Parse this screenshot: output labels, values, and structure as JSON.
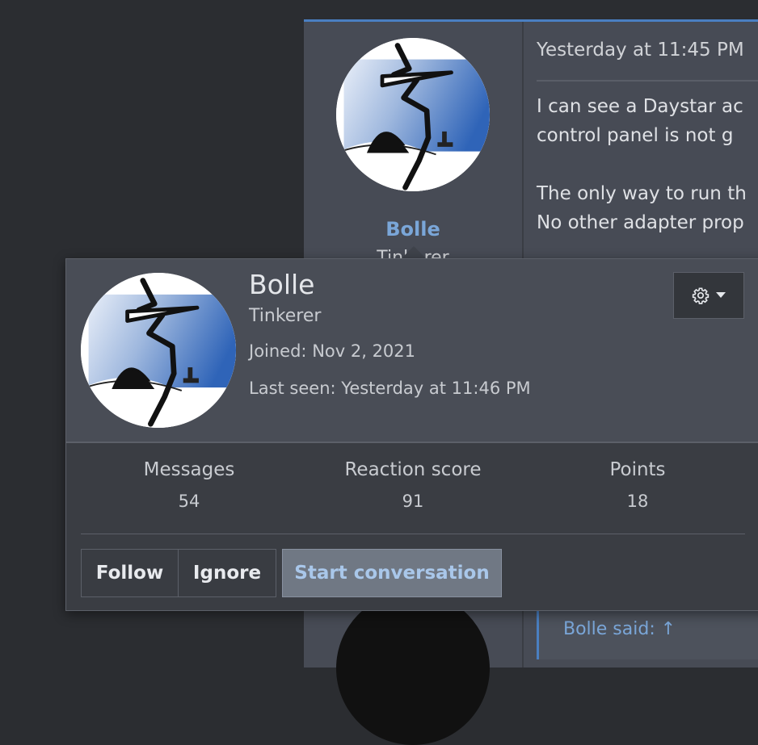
{
  "post": {
    "username": "Bolle",
    "user_title": "Tinkerer",
    "date": "Yesterday at 11:45 PM",
    "body_lines": [
      "I can see a Daystar ac",
      "control panel is not g",
      "The only way to run th",
      "No other adapter prop"
    ],
    "bottom_box_text": "Bolle said: ↑"
  },
  "card": {
    "name": "Bolle",
    "title": "Tinkerer",
    "joined_label": "Joined:",
    "joined_value": "Nov 2, 2021",
    "last_seen_label": "Last seen:",
    "last_seen_value": "Yesterday at 11:46 PM",
    "stats": [
      {
        "label": "Messages",
        "value": "54"
      },
      {
        "label": "Reaction score",
        "value": "91"
      },
      {
        "label": "Points",
        "value": "18"
      }
    ],
    "buttons": {
      "follow": "Follow",
      "ignore": "Ignore",
      "start_conversation": "Start conversation"
    },
    "menu_icon": "gear-icon",
    "menu_caret_icon": "caret-down-icon"
  },
  "colors": {
    "page_bg": "#2b2d31",
    "post_bg": "#474b55",
    "card_bg": "#3a3d43",
    "card_header_bg": "#494d56",
    "link": "#7aa6d8",
    "accent_border": "#4a7fc1"
  }
}
